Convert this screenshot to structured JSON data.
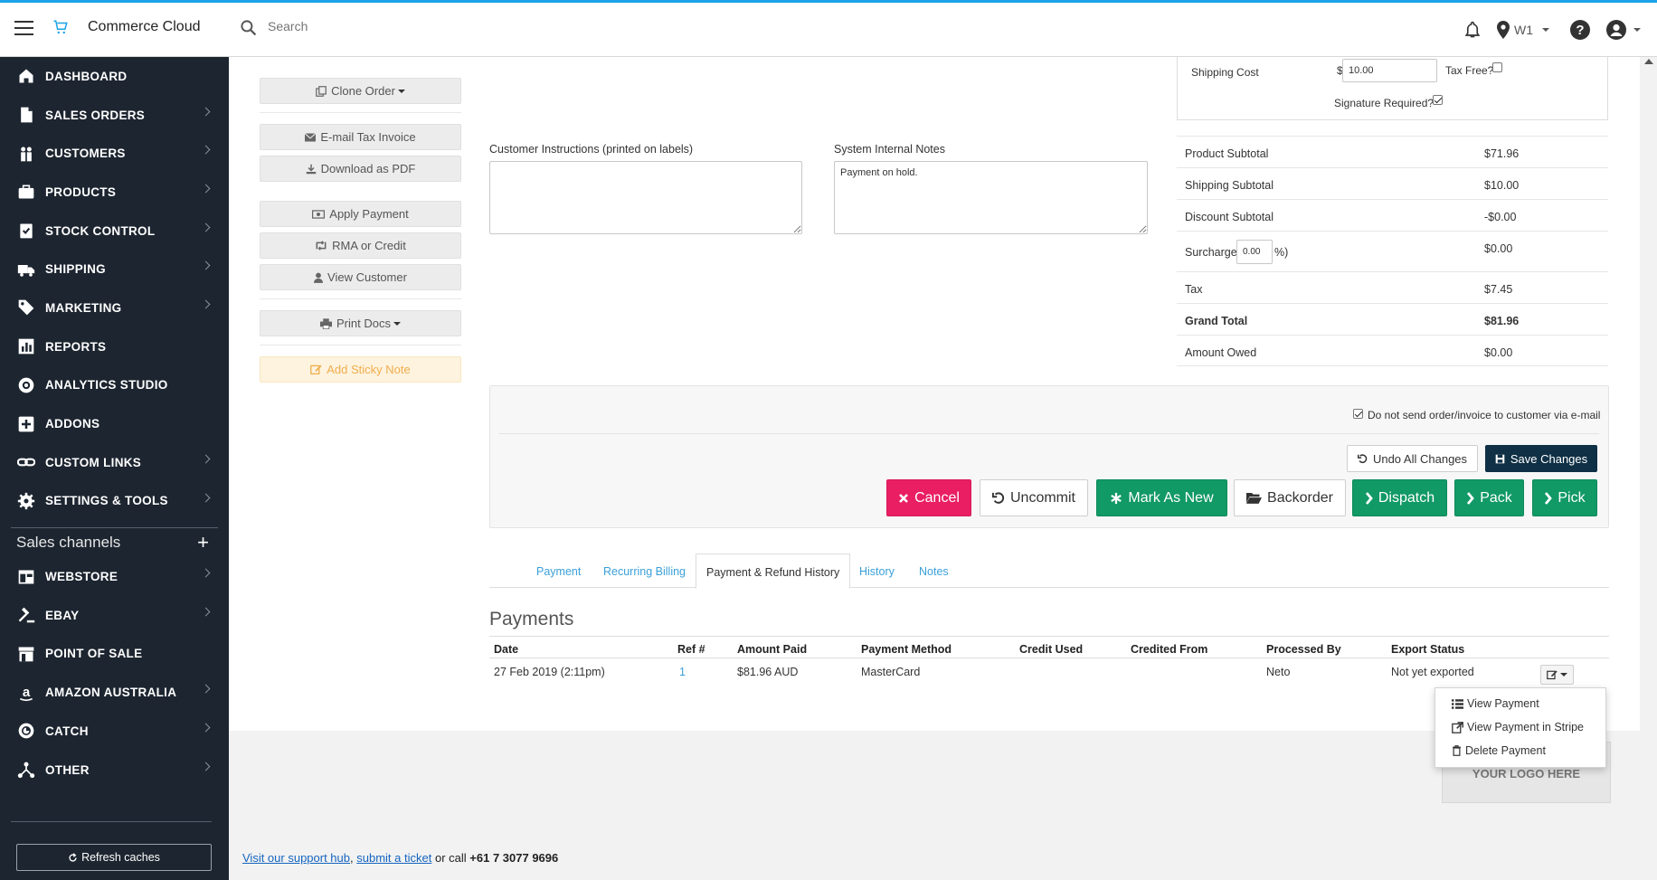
{
  "topbar": {
    "brand": "Commerce Cloud",
    "search_placeholder": "Search",
    "location_label": "W1"
  },
  "sidebar": {
    "items": [
      {
        "label": "DASHBOARD",
        "icon": "home-icon",
        "chevron": false
      },
      {
        "label": "SALES ORDERS",
        "icon": "document-icon",
        "chevron": true
      },
      {
        "label": "CUSTOMERS",
        "icon": "people-icon",
        "chevron": true
      },
      {
        "label": "PRODUCTS",
        "icon": "briefcase-icon",
        "chevron": true
      },
      {
        "label": "STOCK CONTROL",
        "icon": "clipboard-check-icon",
        "chevron": true
      },
      {
        "label": "SHIPPING",
        "icon": "truck-icon",
        "chevron": true
      },
      {
        "label": "MARKETING",
        "icon": "tag-icon",
        "chevron": true
      },
      {
        "label": "REPORTS",
        "icon": "bar-chart-icon",
        "chevron": false
      },
      {
        "label": "ANALYTICS STUDIO",
        "icon": "analytics-icon",
        "chevron": false
      },
      {
        "label": "ADDONS",
        "icon": "plus-square-icon",
        "chevron": false
      },
      {
        "label": "CUSTOM LINKS",
        "icon": "link-icon",
        "chevron": true
      },
      {
        "label": "SETTINGS & TOOLS",
        "icon": "gear-icon",
        "chevron": true
      }
    ],
    "channels_title": "Sales channels",
    "channels": [
      {
        "label": "WEBSTORE",
        "icon": "webstore-icon",
        "chevron": true
      },
      {
        "label": "EBAY",
        "icon": "gavel-icon",
        "chevron": true
      },
      {
        "label": "POINT OF SALE",
        "icon": "store-icon",
        "chevron": false
      },
      {
        "label": "AMAZON AUSTRALIA",
        "icon": "amazon-icon",
        "chevron": true
      },
      {
        "label": "CATCH",
        "icon": "catch-icon",
        "chevron": true
      },
      {
        "label": "OTHER",
        "icon": "network-icon",
        "chevron": true
      }
    ],
    "refresh_label": "Refresh caches"
  },
  "actions": {
    "clone_order": "Clone Order",
    "email_invoice": "E-mail Tax Invoice",
    "download_pdf": "Download as PDF",
    "apply_payment": "Apply Payment",
    "rma_credit": "RMA or Credit",
    "view_customer": "View Customer",
    "print_docs": "Print Docs",
    "add_sticky_note": "Add Sticky Note"
  },
  "notes": {
    "customer_instructions_label": "Customer Instructions (printed on labels)",
    "customer_instructions_value": "",
    "internal_notes_label": "System Internal Notes",
    "internal_notes_value": "Payment on hold."
  },
  "shipping": {
    "cost_label": "Shipping Cost",
    "currency_symbol": "$",
    "cost_value": "10.00",
    "tax_free_label": "Tax Free?",
    "tax_free_checked": false,
    "signature_label": "Signature Required?",
    "signature_checked": true
  },
  "totals": {
    "product_subtotal_label": "Product Subtotal",
    "product_subtotal": "$71.96",
    "shipping_subtotal_label": "Shipping Subtotal",
    "shipping_subtotal": "$10.00",
    "discount_subtotal_label": "Discount Subtotal",
    "discount_subtotal": "-$0.00",
    "surcharge_label_pre": "Surcharge (",
    "surcharge_percent": "0.00",
    "surcharge_label_post": "%)",
    "surcharge": "$0.00",
    "tax_label": "Tax",
    "tax": "$7.45",
    "grand_total_label": "Grand Total",
    "grand_total": "$81.96",
    "amount_owed_label": "Amount Owed",
    "amount_owed": "$0.00"
  },
  "order_actions": {
    "no_email_label": "Do not send order/invoice to customer via e-mail",
    "no_email_checked": true,
    "undo_label": "Undo All Changes",
    "save_label": "Save Changes",
    "cancel_label": "Cancel",
    "uncommit_label": "Uncommit",
    "mark_new_label": "Mark As New",
    "backorder_label": "Backorder",
    "dispatch_label": "Dispatch",
    "pack_label": "Pack",
    "pick_label": "Pick"
  },
  "tabs": [
    "Payment",
    "Recurring Billing",
    "Payment & Refund History",
    "History",
    "Notes"
  ],
  "active_tab": "Payment & Refund History",
  "payments": {
    "title": "Payments",
    "columns": [
      "Date",
      "Ref #",
      "Amount Paid",
      "Payment Method",
      "Credit Used",
      "Credited From",
      "Processed By",
      "Export Status"
    ],
    "rows": [
      {
        "date": "27 Feb 2019 (2:11pm)",
        "ref": "1",
        "amount": "$81.96 AUD",
        "method": "MasterCard",
        "credit_used": "",
        "credited_from": "",
        "processed_by": "Neto",
        "export_status": "Not yet exported"
      }
    ]
  },
  "row_menu": {
    "view_payment": "View Payment",
    "view_stripe": "View Payment in Stripe",
    "delete_payment": "Delete Payment"
  },
  "logo_placeholder": "YOUR LOGO HERE",
  "footer": {
    "support_link": "Visit our support hub",
    "sep": ",",
    "ticket_link": "submit a ticket",
    "call_text": "or call",
    "phone": "+61 7 3077 9696"
  },
  "colors": {
    "accent": "#1aa3e8",
    "sidebar_bg": "#1d2530",
    "cancel": "#e91e63",
    "success": "#119966",
    "save": "#0f3045"
  }
}
